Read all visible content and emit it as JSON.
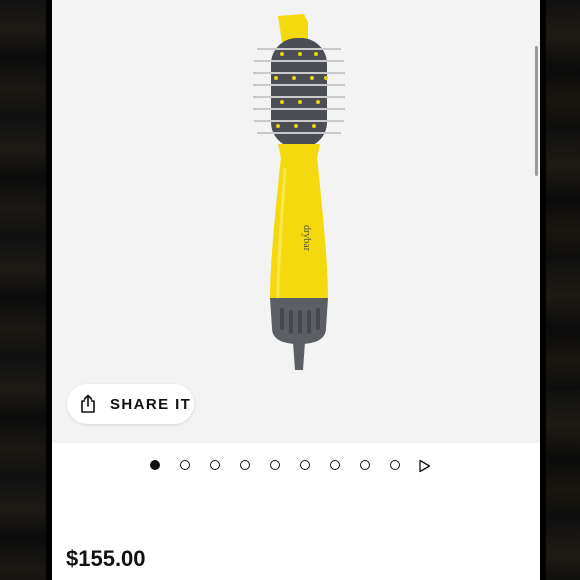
{
  "product": {
    "brand_mark": "drybar",
    "price": "$155.00"
  },
  "share": {
    "label": "SHARE IT",
    "icon": "share-icon"
  },
  "gallery": {
    "total_images": 9,
    "current_image": 1,
    "next_icon": "play-arrow-icon"
  },
  "colors": {
    "brush_yellow": "#f5d90f",
    "bristle_gray": "#4b4f55",
    "card_background": "#ffffff",
    "image_background": "#f3f3f3"
  }
}
